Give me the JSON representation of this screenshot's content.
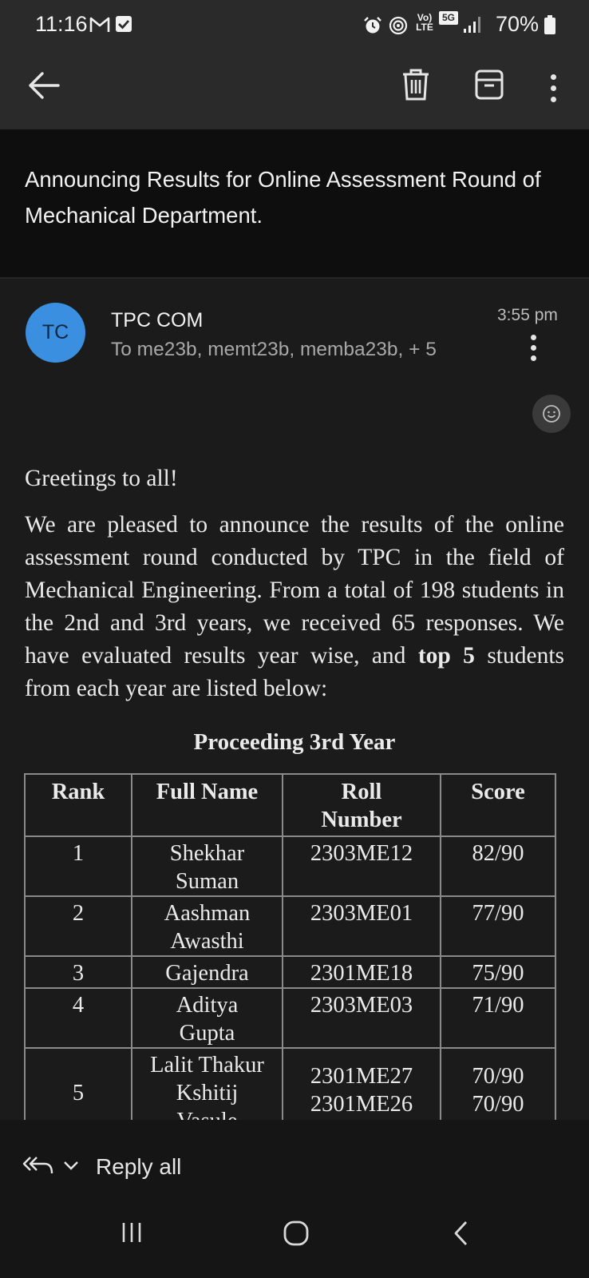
{
  "status_bar": {
    "time": "11:16",
    "battery": "70%",
    "network": "5G",
    "volte": "Vo) LTE",
    "icons": [
      "gmail-icon",
      "checkbox-icon",
      "alarm-icon",
      "hotspot-icon",
      "volte-icon",
      "5g-icon",
      "signal-icon",
      "battery-icon"
    ]
  },
  "toolbar": {
    "icons": [
      "back-arrow-icon",
      "delete-icon",
      "archive-icon",
      "more-options-icon"
    ]
  },
  "email": {
    "subject": "Announcing Results for Online Assessment Round of Mechanical Department.",
    "sender_initials": "TC",
    "sender_name": "TPC COM",
    "recipients": "To me23b, memt23b, memba23b, + 5",
    "time": "3:55 pm",
    "avatar_color": "#3b8fe0"
  },
  "body": {
    "greeting": "Greetings to all!",
    "paragraph_text": "We are pleased to announce the results of the online assessment round conducted by TPC in the field of Mechanical Engineering. From a total of 198 students in the 2nd and 3rd years, we received 65 responses. We have evaluated results year wise, and",
    "paragraph_bold": "top 5",
    "paragraph_tail": "students from each year are listed below:"
  },
  "results_table": {
    "title": "Proceeding 3rd Year",
    "headers": {
      "rank": "Rank",
      "name": "Full Name",
      "roll": "Roll Number",
      "score": "Score"
    },
    "rows": [
      {
        "rank": "1",
        "name": "Shekhar Suman",
        "roll": "2303ME12",
        "score": "82/90"
      },
      {
        "rank": "2",
        "name": "Aashman Awasthi",
        "roll": "2303ME01",
        "score": "77/90"
      },
      {
        "rank": "3",
        "name": "Gajendra",
        "roll": "2301ME18",
        "score": "75/90"
      },
      {
        "rank": "4",
        "name": "Aditya Gupta",
        "roll": "2303ME03",
        "score": "71/90"
      },
      {
        "rank": "5",
        "name_1": "Lalit Thakur",
        "name_2": "Kshitij Vasule",
        "roll_1": "2301ME27",
        "roll_2": "2301ME26",
        "score_1": "70/90",
        "score_2": "70/90"
      }
    ]
  },
  "bottom_bar": {
    "reply_label": "Reply all",
    "icons": [
      "reply-all-icon",
      "chevron-down-icon"
    ]
  },
  "nav_bar": {
    "icons": [
      "recent-apps-icon",
      "home-icon",
      "nav-back-icon"
    ]
  }
}
